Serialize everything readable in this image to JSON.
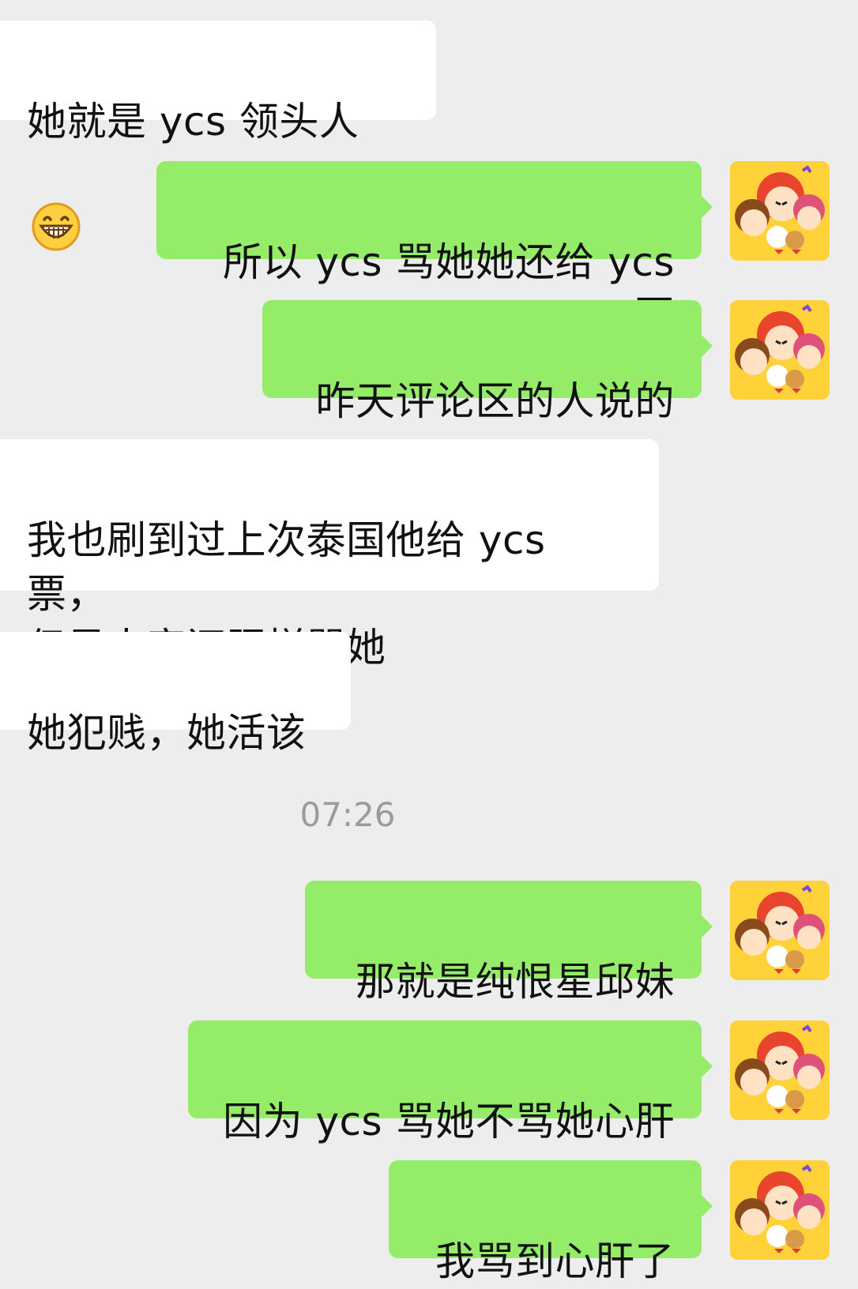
{
  "conversation": {
    "messages": [
      {
        "side": "left",
        "text": "她就是 ycs 领头人"
      },
      {
        "side": "right",
        "text": "所以 ycs 骂她她还给 ycs 票"
      },
      {
        "side": "right",
        "text": "昨天评论区的人说的"
      },
      {
        "side": "left",
        "text": "我也刷到过上次泰国他给 ycs 票，\n但是人家还照样骂她"
      },
      {
        "side": "left",
        "text": "她犯贱，她活该"
      },
      {
        "side": "right",
        "text": "那就是纯恨星邱妹"
      },
      {
        "side": "right",
        "text": "因为 ycs 骂她不骂她心肝"
      },
      {
        "side": "right",
        "text": "我骂到心肝了"
      }
    ],
    "timestamp": "07:26",
    "emoji_name": "grinning-face-icon",
    "colors": {
      "background": "#ededed",
      "incoming_bubble": "#ffffff",
      "outgoing_bubble": "#95ec69",
      "timestamp": "#9b9b9b"
    }
  }
}
